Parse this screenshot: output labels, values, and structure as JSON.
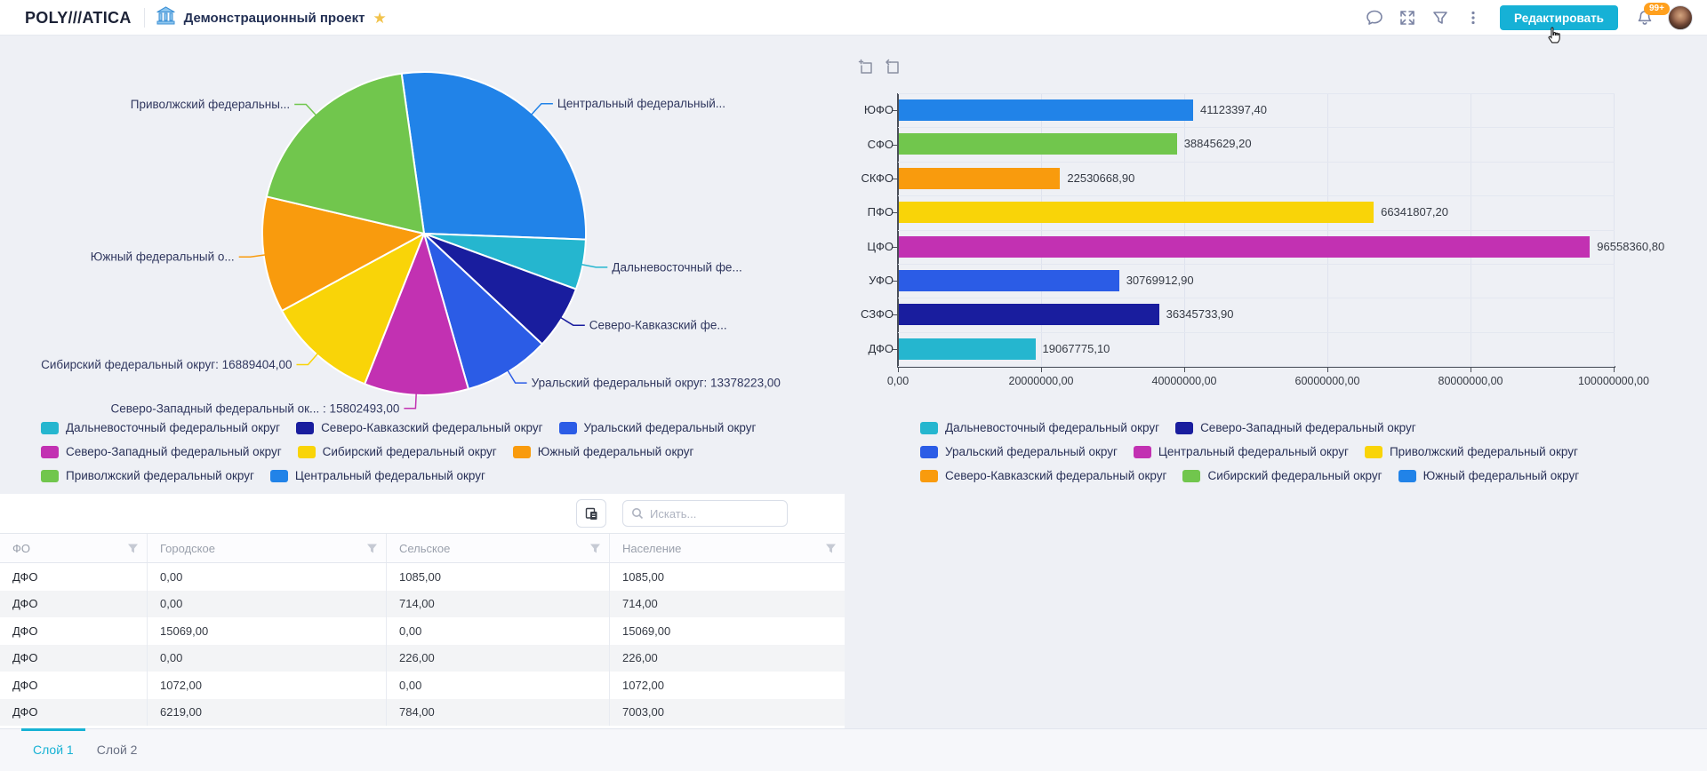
{
  "header": {
    "logo_text": "POLY///ATICA",
    "project_title": "Демонстрационный проект",
    "edit_button_label": "Редактировать",
    "notification_count": "99+",
    "icons": [
      "bank-icon",
      "star-icon",
      "comments-icon",
      "fullscreen-icon",
      "filter-icon",
      "more-options-icon",
      "notifications-bell-icon",
      "user-avatar"
    ]
  },
  "colors": {
    "accent_cyan": "#17b2d4",
    "badge_orange": "#ffa01e",
    "star_gold": "#f2c34b",
    "page_background": "#eef0f5"
  },
  "chart_data": [
    {
      "type": "pie",
      "name": "population-by-federal-district",
      "start_angle_deg": -8,
      "slices": [
        {
          "district": "Центральный федеральный округ",
          "callout": "Центральный федеральный...",
          "value": null,
          "share_pct": 27.8,
          "color": "#2183e8"
        },
        {
          "district": "Дальневосточный федеральный округ",
          "callout": "Дальневосточный фе...",
          "value": null,
          "share_pct": 5.0,
          "color": "#25b6cf"
        },
        {
          "district": "Северо-Кавказский федеральный округ",
          "callout": "Северо-Кавказский фе...",
          "value": null,
          "share_pct": 6.4,
          "color": "#191d9e"
        },
        {
          "district": "Уральский федеральный округ",
          "callout": "Уральский федеральный округ: 13378223,00",
          "value": 13378223.0,
          "share_pct": 8.6,
          "color": "#2b5ce6"
        },
        {
          "district": "Северо-Западный федеральный округ",
          "callout": "Северо-Западный федеральный ок... : 15802493,00",
          "value": 15802493.0,
          "share_pct": 10.4,
          "color": "#c231b2"
        },
        {
          "district": "Сибирский федеральный округ",
          "callout": "Сибирский федеральный округ: 16889404,00",
          "value": 16889404.0,
          "share_pct": 11.1,
          "color": "#f9d408"
        },
        {
          "district": "Южный федеральный округ",
          "callout": "Южный федеральный о...",
          "value": null,
          "share_pct": 11.6,
          "color": "#f99b0d"
        },
        {
          "district": "Приволжский федеральный округ",
          "callout": "Приволжский федеральны...",
          "value": null,
          "share_pct": 19.1,
          "color": "#71c64d"
        }
      ],
      "legend_rows": [
        [
          {
            "label": "Дальневосточный федеральный округ",
            "color": "#25b6cf"
          },
          {
            "label": "Северо-Кавказский федеральный округ",
            "color": "#191d9e"
          },
          {
            "label": "Уральский федеральный округ",
            "color": "#2b5ce6"
          }
        ],
        [
          {
            "label": "Северо-Западный федеральный округ",
            "color": "#c231b2"
          },
          {
            "label": "Сибирский федеральный округ",
            "color": "#f9d408"
          },
          {
            "label": "Южный федеральный округ",
            "color": "#f99b0d"
          }
        ],
        [
          {
            "label": "Приволжский федеральный округ",
            "color": "#71c64d"
          },
          {
            "label": "Центральный федеральный округ",
            "color": "#2183e8"
          }
        ]
      ]
    },
    {
      "type": "bar",
      "name": "values-by-federal-district",
      "orientation": "horizontal",
      "toolbar_icons": [
        "zoom-frame-plus-icon",
        "step-back-icon"
      ],
      "categories": [
        "ЮФО",
        "СФО",
        "СКФО",
        "ПФО",
        "ЦФО",
        "УФО",
        "СЗФО",
        "ДФО"
      ],
      "values": [
        41123397.4,
        38845629.2,
        22530668.9,
        66341807.2,
        96558360.8,
        30769912.9,
        36345733.9,
        19067775.1
      ],
      "value_labels": [
        "41123397,40",
        "38845629,20",
        "22530668,90",
        "66341807,20",
        "96558360,80",
        "30769912,90",
        "36345733,90",
        "19067775,10"
      ],
      "bar_colors": [
        "#2183e8",
        "#71c64d",
        "#f99b0d",
        "#f9d408",
        "#c231b2",
        "#2b5ce6",
        "#191d9e",
        "#25b6cf"
      ],
      "xlim": [
        0,
        100000000
      ],
      "x_tick_labels": [
        "0,00",
        "20000000,00",
        "40000000,00",
        "60000000,00",
        "80000000,00",
        "100000000,00"
      ],
      "grid": true,
      "legend_rows": [
        [
          {
            "label": "Дальневосточный федеральный округ",
            "color": "#25b6cf"
          },
          {
            "label": "Северо-Западный федеральный округ",
            "color": "#191d9e"
          }
        ],
        [
          {
            "label": "Уральский федеральный округ",
            "color": "#2b5ce6"
          },
          {
            "label": "Центральный федеральный округ",
            "color": "#c231b2"
          },
          {
            "label": "Приволжский федеральный округ",
            "color": "#f9d408"
          }
        ],
        [
          {
            "label": "Северо-Кавказский федеральный округ",
            "color": "#f99b0d"
          },
          {
            "label": "Сибирский федеральный округ",
            "color": "#71c64d"
          },
          {
            "label": "Южный федеральный округ",
            "color": "#2183e8"
          }
        ]
      ]
    }
  ],
  "table": {
    "toolbar": {
      "copy_icon": "copy-icon",
      "search_placeholder": "Искать...",
      "search_value": ""
    },
    "columns": [
      "ФО",
      "Городское",
      "Сельское",
      "Население"
    ],
    "rows": [
      [
        "ДФО",
        "0,00",
        "1085,00",
        "1085,00"
      ],
      [
        "ДФО",
        "0,00",
        "714,00",
        "714,00"
      ],
      [
        "ДФО",
        "15069,00",
        "0,00",
        "15069,00"
      ],
      [
        "ДФО",
        "0,00",
        "226,00",
        "226,00"
      ],
      [
        "ДФО",
        "1072,00",
        "0,00",
        "1072,00"
      ],
      [
        "ДФО",
        "6219,00",
        "784,00",
        "7003,00"
      ]
    ]
  },
  "tabs": [
    {
      "label": "Слой 1",
      "active": true
    },
    {
      "label": "Слой 2",
      "active": false
    }
  ]
}
